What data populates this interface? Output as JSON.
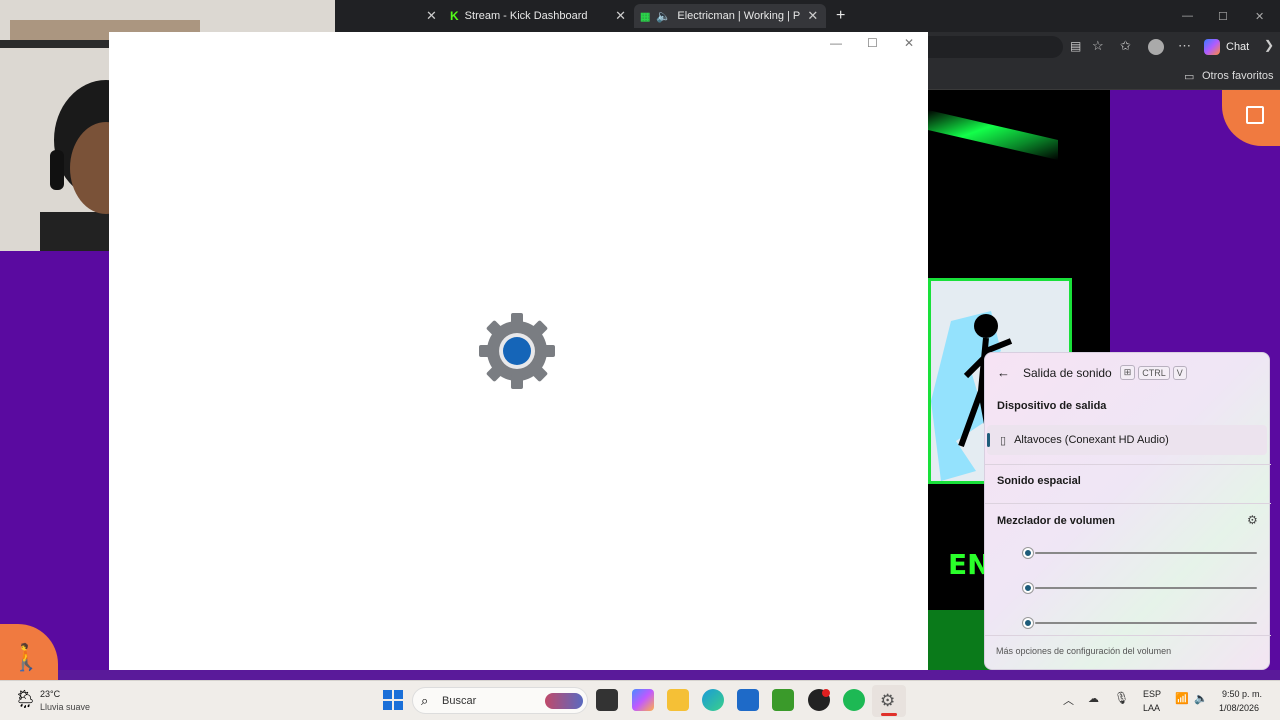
{
  "browser": {
    "tabs": [
      {
        "label": "Stream - Kick Dashboard"
      },
      {
        "label": "Electricman | Working | Play It"
      }
    ],
    "new_tab": "+",
    "tab_close": "✕",
    "chat_label": "Chat",
    "favorites_label": "Otros favoritos"
  },
  "settings_window": {
    "minimize": "—",
    "maximize": "☐",
    "close": "✕"
  },
  "game": {
    "banner_text": "EN"
  },
  "flyout": {
    "title": "Salida de sonido",
    "shortcut_keys": [
      "⊞",
      "CTRL",
      "V"
    ],
    "output_section": "Dispositivo de salida",
    "device": "Altavoces (Conexant HD Audio)",
    "spatial": "Sonido espacial",
    "mixer": "Mezclador de volumen",
    "sliders": [
      0.0,
      0.0,
      0.0
    ],
    "more_options": "Más opciones de configuración del volumen"
  },
  "taskbar": {
    "weather_temp": "23°C",
    "weather_desc": "Lluvia suave",
    "search_placeholder": "Buscar",
    "lang_top": "ESP",
    "lang_bottom": "LAA",
    "time": "9:50 p. m.",
    "date": "1/08/2026"
  },
  "colors": {
    "accent": "#1e5c7a",
    "page_purple": "#5a0aa0",
    "game_green": "#19e03a"
  }
}
